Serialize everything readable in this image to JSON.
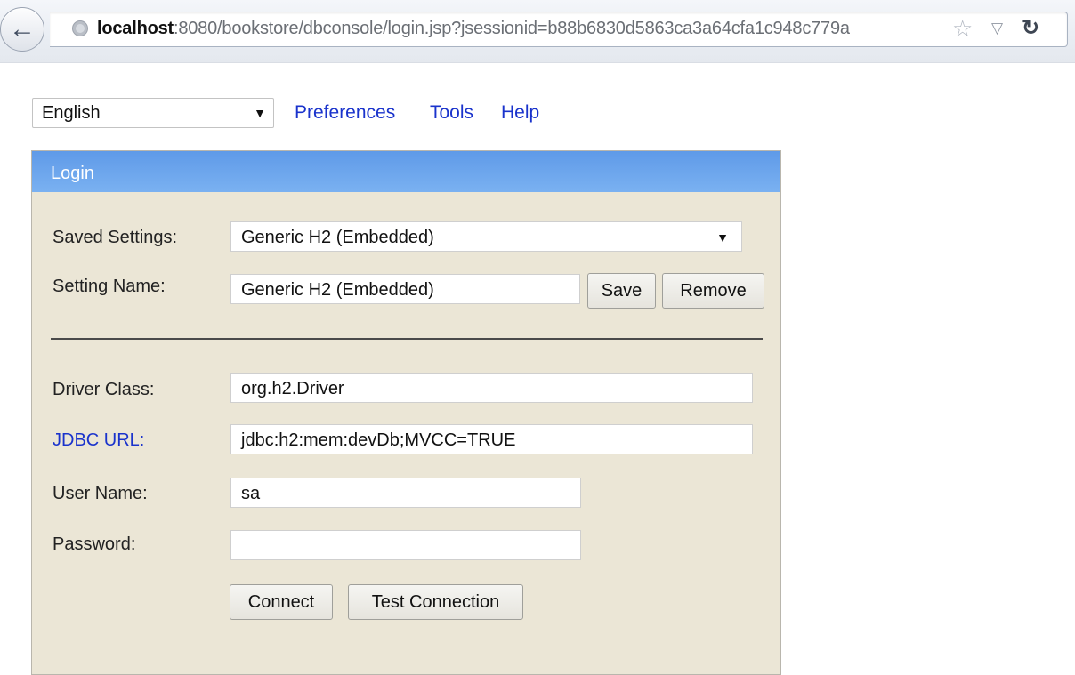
{
  "browser": {
    "url_host": "localhost",
    "url_rest": ":8080/bookstore/dbconsole/login.jsp?jsessionid=b88b6830d5863ca3a64cfa1c948c779a",
    "icons": {
      "back": "back-arrow-icon",
      "site": "globe-icon",
      "bookmark": "star-icon",
      "history": "dropdown-triangle-icon",
      "reload": "reload-icon"
    }
  },
  "topbar": {
    "language": "English",
    "links": [
      "Preferences",
      "Tools",
      "Help"
    ]
  },
  "login": {
    "title": "Login",
    "saved_settings_label": "Saved Settings:",
    "saved_settings_value": "Generic H2 (Embedded)",
    "setting_name_label": "Setting Name:",
    "setting_name_value": "Generic H2 (Embedded)",
    "save_label": "Save",
    "remove_label": "Remove",
    "driver_class_label": "Driver Class:",
    "driver_class_value": "org.h2.Driver",
    "jdbc_url_label": "JDBC URL:",
    "jdbc_url_value": "jdbc:h2:mem:devDb;MVCC=TRUE",
    "user_name_label": "User Name:",
    "user_name_value": "sa",
    "password_label": "Password:",
    "password_value": "",
    "connect_label": "Connect",
    "test_connection_label": "Test Connection"
  },
  "colors": {
    "header_blue": "#6ea6ee",
    "panel_bg": "#ebe6d6",
    "link": "#1a33cc"
  }
}
